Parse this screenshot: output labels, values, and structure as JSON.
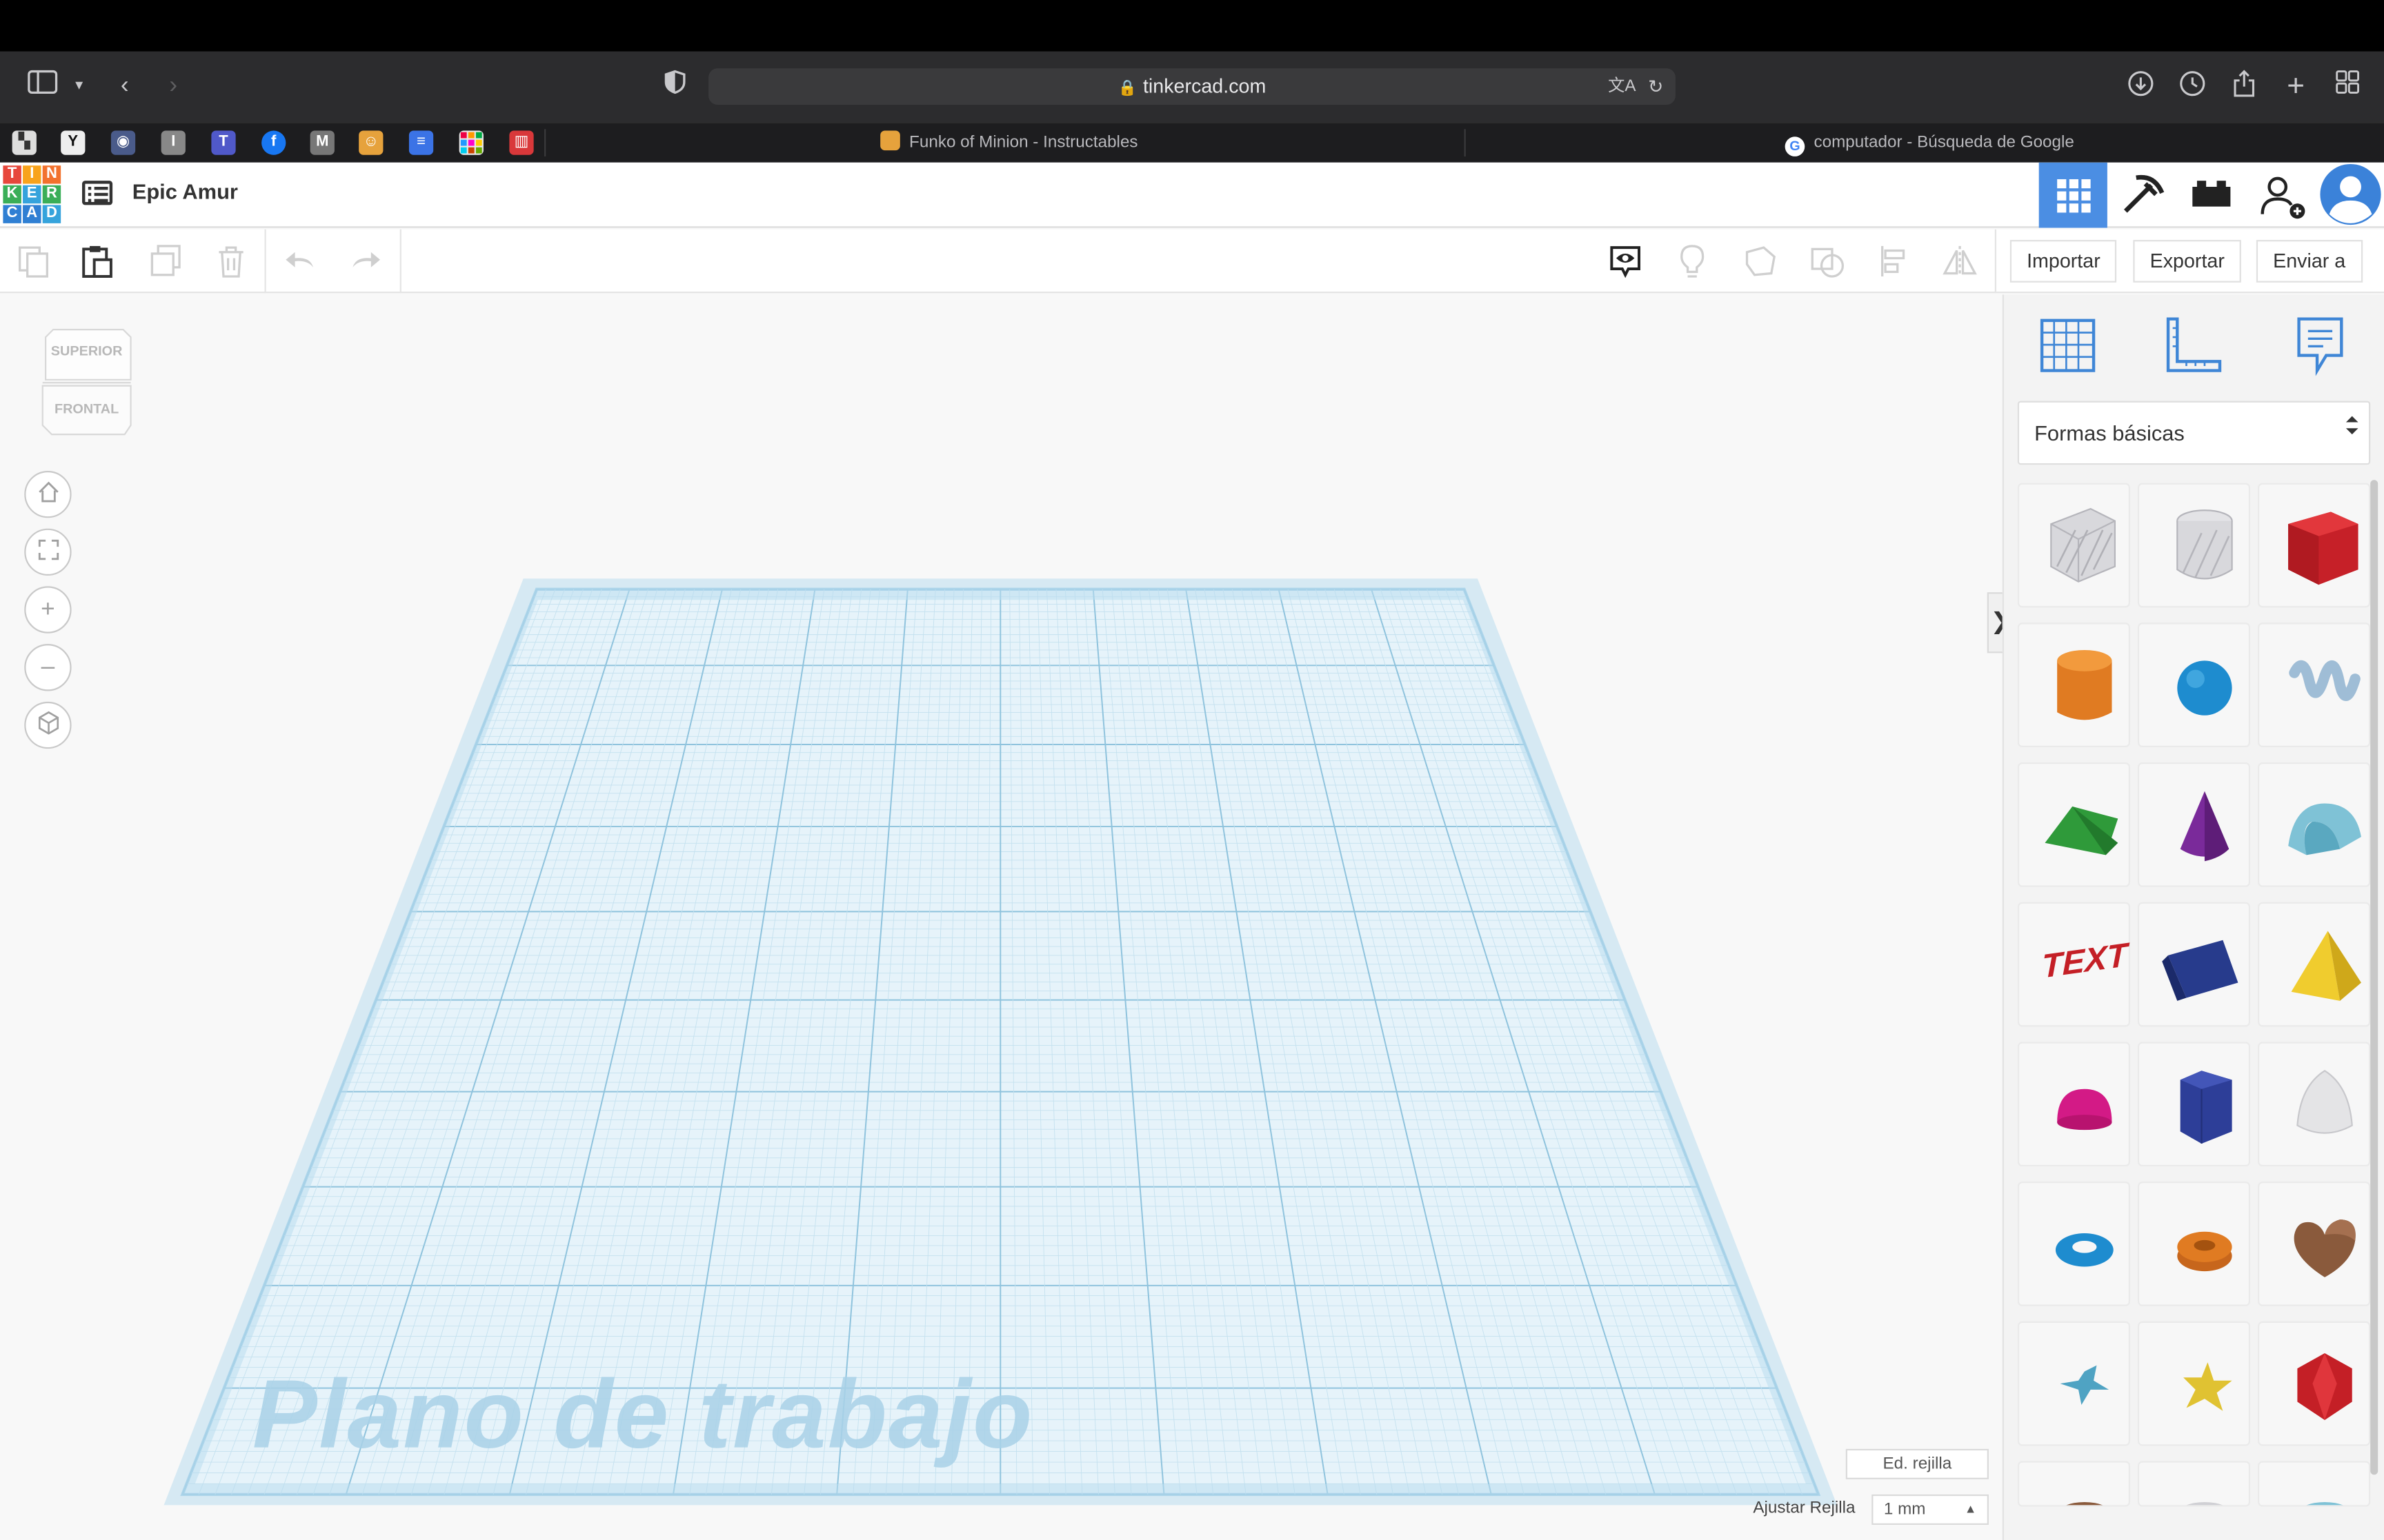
{
  "browser": {
    "url": "tinkercad.com",
    "tabs": [
      {
        "title": "Funko of Minion - Instructables",
        "active": false
      },
      {
        "title": "computador - Búsqueda de Google",
        "active": false
      }
    ],
    "bookmark_icons": [
      "bookmark-1",
      "yahoo-y",
      "shield-badge",
      "instructables-i",
      "teams-icon",
      "facebook-f",
      "medium-m",
      "minion-icon",
      "docs-icon",
      "calendar-icon",
      "book-icon"
    ]
  },
  "app": {
    "logo_letters": [
      "T",
      "I",
      "N",
      "K",
      "E",
      "R",
      "C",
      "A",
      "D"
    ],
    "design_title": "Epic Amur",
    "header_buttons": [
      "3d-design",
      "circuits",
      "bricks",
      "add-user",
      "profile"
    ]
  },
  "toolbar": {
    "import_label": "Importar",
    "export_label": "Exportar",
    "send_label": "Enviar a"
  },
  "viewcube": {
    "top_label": "SUPERIOR",
    "front_label": "FRONTAL"
  },
  "workplane": {
    "watermark": "Plano de trabajo",
    "edit_grid_label": "Ed. rejilla",
    "snap_label": "Ajustar Rejilla",
    "snap_value": "1 mm"
  },
  "library": {
    "category": "Formas básicas",
    "shapes": [
      "box-hole",
      "cylinder-hole",
      "box",
      "cylinder",
      "sphere",
      "scribble",
      "roof",
      "cone",
      "round-roof",
      "text",
      "wedge",
      "pyramid",
      "half-sphere",
      "polygon",
      "paraboloid",
      "torus",
      "tube",
      "heart",
      "star",
      "star-gold",
      "icosahedron"
    ]
  },
  "colors": {
    "accent": "#4b8ee3",
    "grid": "#b9dcee",
    "watermark": "#a9d2e8"
  }
}
